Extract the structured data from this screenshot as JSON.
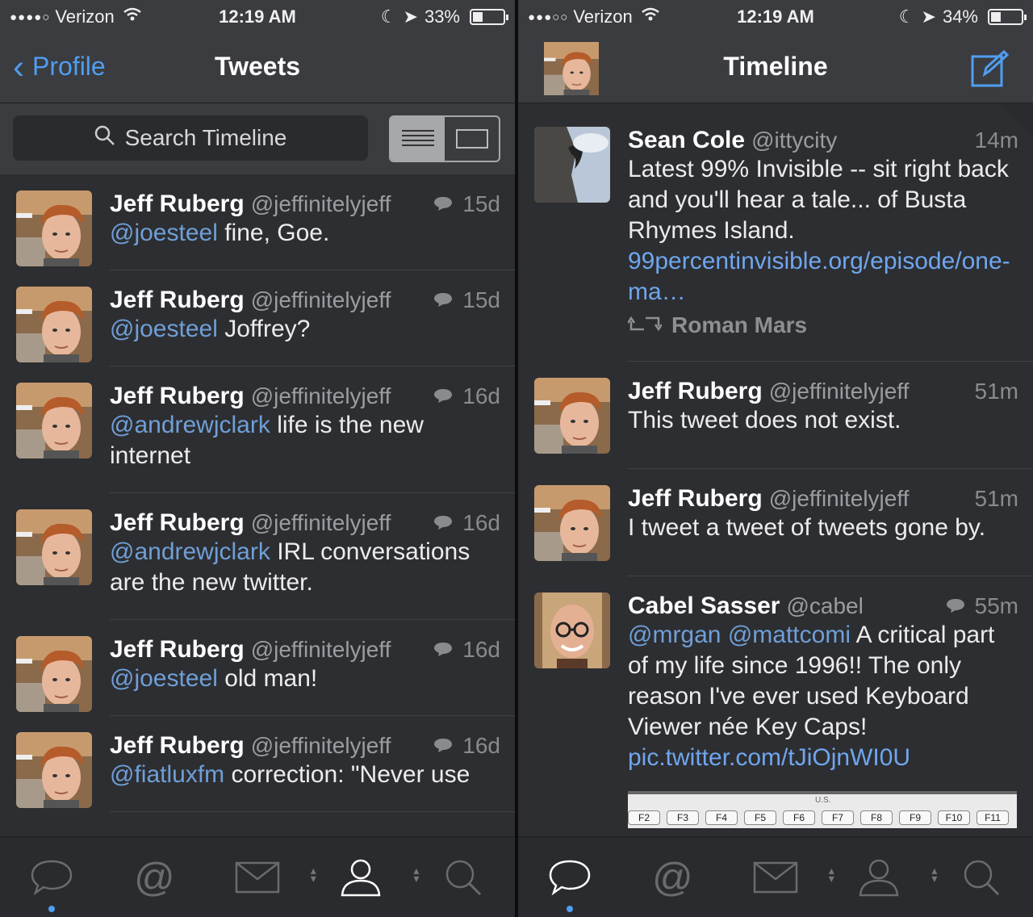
{
  "left": {
    "status": {
      "carrier": "Verizon",
      "signal_dots": "●●●●○",
      "time": "12:19 AM",
      "battery": "33%",
      "battery_level": 0.33
    },
    "nav": {
      "back_label": "Profile",
      "title": "Tweets"
    },
    "search": {
      "placeholder": "Search Timeline"
    },
    "tweets": [
      {
        "name": "Jeff Ruberg",
        "handle": "@jeffinitelyjeff",
        "age": "15d",
        "mention": "@joesteel",
        "text": " fine, Goe."
      },
      {
        "name": "Jeff Ruberg",
        "handle": "@jeffinitelyjeff",
        "age": "15d",
        "mention": "@joesteel",
        "text": " Joffrey?"
      },
      {
        "name": "Jeff Ruberg",
        "handle": "@jeffinitelyjeff",
        "age": "16d",
        "mention": "@andrewjclark",
        "text": " life is the new internet"
      },
      {
        "name": "Jeff Ruberg",
        "handle": "@jeffinitelyjeff",
        "age": "16d",
        "mention": "@andrewjclark",
        "text": " IRL conversations are the new twitter."
      },
      {
        "name": "Jeff Ruberg",
        "handle": "@jeffinitelyjeff",
        "age": "16d",
        "mention": "@joesteel",
        "text": " old man!"
      },
      {
        "name": "Jeff Ruberg",
        "handle": "@jeffinitelyjeff",
        "age": "16d",
        "mention": "@fiatluxfm",
        "text": " correction: \"Never use"
      }
    ],
    "tabs": [
      "timeline-tab",
      "mentions-tab",
      "messages-tab",
      "profile-tab",
      "search-tab"
    ]
  },
  "right": {
    "status": {
      "carrier": "Verizon",
      "signal_dots": "●●●○○",
      "time": "12:19 AM",
      "battery": "34%",
      "battery_level": 0.34
    },
    "nav": {
      "title": "Timeline"
    },
    "tweets": [
      {
        "name": "Sean Cole",
        "handle": "@ittycity",
        "age": "14m",
        "text": "Latest 99% Invisible -- sit right back and you'll hear a tale... of Busta Rhymes Island.",
        "link": "99percentinvisible.org/episode/one-ma…",
        "retweeted_by": "Roman Mars"
      },
      {
        "name": "Jeff Ruberg",
        "handle": "@jeffinitelyjeff",
        "age": "51m",
        "text": "This tweet does not exist."
      },
      {
        "name": "Jeff Ruberg",
        "handle": "@jeffinitelyjeff",
        "age": "51m",
        "text": "I tweet a tweet of tweets gone by."
      },
      {
        "name": "Cabel Sasser",
        "handle": "@cabel",
        "age": "55m",
        "mention1": "@mrgan",
        "mention2": "@mattcomi",
        "text": " A critical part of my life since 1996!! The only reason I've ever used Keyboard Viewer née Key Caps!",
        "link": "pic.twitter.com/tJiOjnWI0U"
      }
    ],
    "media": {
      "label": "U.S.",
      "keys": [
        "F2",
        "F3",
        "F4",
        "F5",
        "F6",
        "F7",
        "F8",
        "F9",
        "F10",
        "F11"
      ]
    }
  },
  "colors": {
    "accent": "#4f9ef0",
    "mention": "#6f9fd8",
    "background": "#2d2e31",
    "bar": "#3b3c40"
  }
}
